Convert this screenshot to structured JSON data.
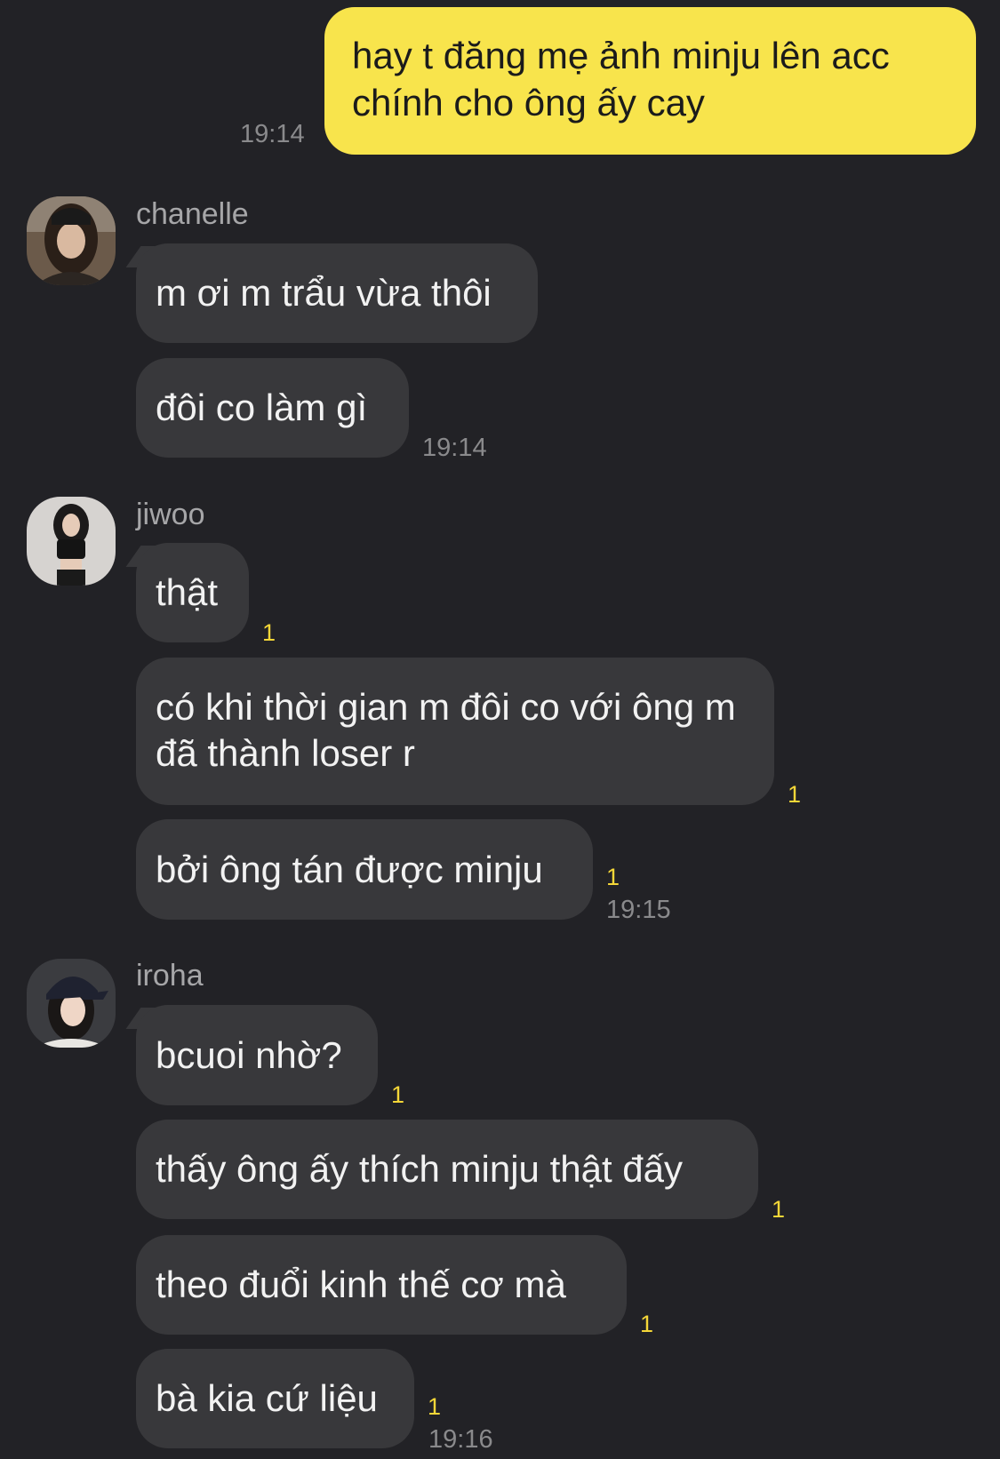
{
  "outgoing": {
    "text": "hay t đăng mẹ ảnh minju lên acc chính cho ông ấy cay",
    "time": "19:14"
  },
  "groups": [
    {
      "sender": "chanelle",
      "avatar": "chanelle-avatar",
      "messages": [
        {
          "text": "m ơi m trẩu vừa thôi",
          "unread": ""
        },
        {
          "text": "đôi co làm gì",
          "unread": ""
        }
      ],
      "time": "19:14"
    },
    {
      "sender": "jiwoo",
      "avatar": "jiwoo-avatar",
      "messages": [
        {
          "text": "thật",
          "unread": "1"
        },
        {
          "text": "có khi thời gian m đôi co với ông m đã thành loser r",
          "unread": "1"
        },
        {
          "text": "bởi ông tán được minju",
          "unread": "1"
        }
      ],
      "time": "19:15"
    },
    {
      "sender": "iroha",
      "avatar": "iroha-avatar",
      "messages": [
        {
          "text": "bcuoi nhờ?",
          "unread": "1"
        },
        {
          "text": "thấy ông ấy thích minju thật đấy",
          "unread": "1"
        },
        {
          "text": "theo đuổi kinh thế cơ mà",
          "unread": "1"
        },
        {
          "text": "bà kia cứ liệu",
          "unread": "1"
        }
      ],
      "time": "19:16"
    }
  ],
  "colors": {
    "background": "#222226",
    "outgoing_bubble": "#f8e44c",
    "incoming_bubble": "#38383b",
    "unread": "#f5d738"
  }
}
